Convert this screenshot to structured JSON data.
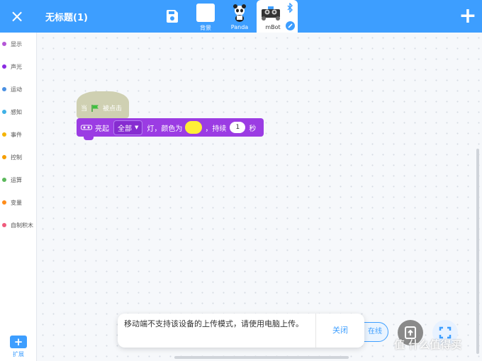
{
  "header": {
    "close_icon": "×",
    "title": "无标题(1)",
    "add_icon": "+"
  },
  "tabs": [
    {
      "label": "背景"
    },
    {
      "label": "Panda"
    },
    {
      "label": "mBot"
    }
  ],
  "sidebar": {
    "categories": [
      {
        "label": "显示",
        "color": "#b456d6"
      },
      {
        "label": "声光",
        "color": "#8a2be2"
      },
      {
        "label": "运动",
        "color": "#4a90e2"
      },
      {
        "label": "感知",
        "color": "#3fb1e6"
      },
      {
        "label": "事件",
        "color": "#f5b400"
      },
      {
        "label": "控制",
        "color": "#f59e00"
      },
      {
        "label": "运算",
        "color": "#5cb85c"
      },
      {
        "label": "变量",
        "color": "#ff8c1a"
      },
      {
        "label": "自制积木",
        "color": "#ef5b7c"
      }
    ],
    "extension": {
      "icon": "+",
      "label": "扩展"
    }
  },
  "blocks": {
    "hat": {
      "when": "当",
      "clicked": "被点击"
    },
    "action": {
      "light_on": "亮起",
      "dropdown_value": "全部",
      "dropdown_arrow": "▼",
      "light_color_text": "灯，颜色为",
      "duration_text": "，持续",
      "duration_value": "1",
      "seconds": "秒",
      "swatch_color": "#ffef36"
    }
  },
  "bottom": {
    "online_label": "在线"
  },
  "toast": {
    "message": "移动端不支持该设备的上传模式，请使用电脑上传。",
    "close_label": "关闭"
  },
  "watermark": "值 什么值得买",
  "colors": {
    "accent": "#3d9eff",
    "block_purple": "#9b3ce3",
    "hat_block": "#cfd0b2"
  }
}
